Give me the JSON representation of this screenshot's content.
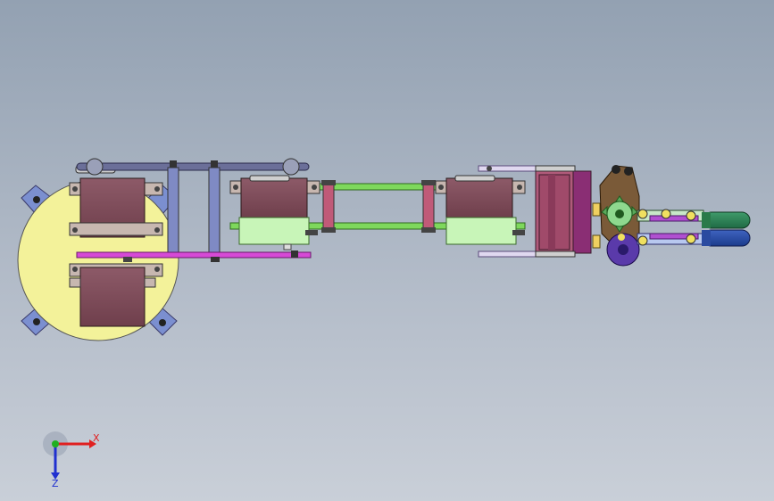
{
  "viewport": {
    "background_top": "#93a1b2",
    "background_bottom": "#c9cfd8"
  },
  "model": {
    "parts": [
      "base-plate",
      "base-servo-top",
      "base-servo-bottom",
      "shoulder-link",
      "upper-arm-link",
      "elbow-servo",
      "wrist-servo",
      "wrist-bracket",
      "gripper-gear-assembly",
      "gripper-fingers"
    ]
  },
  "triad": {
    "x_label": "X",
    "z_label": "Z",
    "x_color": "#e02020",
    "y_color": "#20b020",
    "z_color": "#2030d0"
  }
}
